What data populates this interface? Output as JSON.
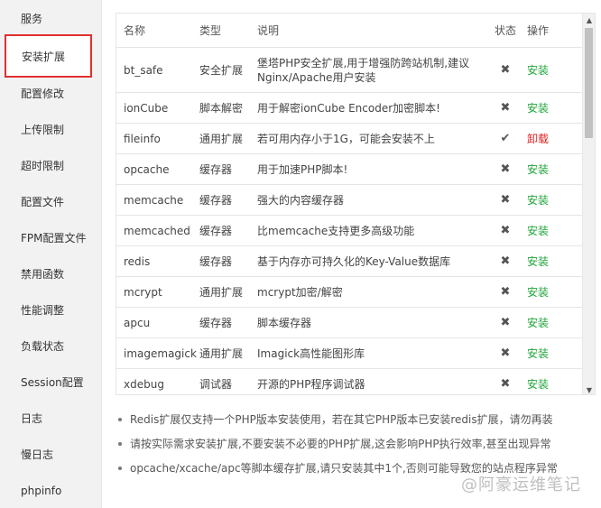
{
  "sidebar": {
    "items": [
      {
        "label": "服务"
      },
      {
        "label": "安装扩展"
      },
      {
        "label": "配置修改"
      },
      {
        "label": "上传限制"
      },
      {
        "label": "超时限制"
      },
      {
        "label": "配置文件"
      },
      {
        "label": "FPM配置文件"
      },
      {
        "label": "禁用函数"
      },
      {
        "label": "性能调整"
      },
      {
        "label": "负载状态"
      },
      {
        "label": "Session配置"
      },
      {
        "label": "日志"
      },
      {
        "label": "慢日志"
      },
      {
        "label": "phpinfo"
      }
    ],
    "active": "安装扩展"
  },
  "table": {
    "headers": {
      "name": "名称",
      "type": "类型",
      "desc": "说明",
      "status": "状态",
      "op": "操作"
    },
    "rows": [
      {
        "name": "bt_safe",
        "type": "安全扩展",
        "desc": "堡塔PHP安全扩展,用于增强防跨站机制,建议Nginx/Apache用户安装",
        "status": "✖",
        "op": "安装"
      },
      {
        "name": "ionCube",
        "type": "脚本解密",
        "desc": "用于解密ionCube Encoder加密脚本!",
        "status": "✖",
        "op": "安装"
      },
      {
        "name": "fileinfo",
        "type": "通用扩展",
        "desc": "若可用内存小于1G，可能会安装不上",
        "status": "✔",
        "op": "卸载"
      },
      {
        "name": "opcache",
        "type": "缓存器",
        "desc": "用于加速PHP脚本!",
        "status": "✖",
        "op": "安装"
      },
      {
        "name": "memcache",
        "type": "缓存器",
        "desc": "强大的内容缓存器",
        "status": "✖",
        "op": "安装"
      },
      {
        "name": "memcached",
        "type": "缓存器",
        "desc": "比memcache支持更多高级功能",
        "status": "✖",
        "op": "安装"
      },
      {
        "name": "redis",
        "type": "缓存器",
        "desc": "基于内存亦可持久化的Key-Value数据库",
        "status": "✖",
        "op": "安装"
      },
      {
        "name": "mcrypt",
        "type": "通用扩展",
        "desc": "mcrypt加密/解密",
        "status": "✖",
        "op": "安装"
      },
      {
        "name": "apcu",
        "type": "缓存器",
        "desc": "脚本缓存器",
        "status": "✖",
        "op": "安装"
      },
      {
        "name": "imagemagick",
        "type": "通用扩展",
        "desc": "Imagick高性能图形库",
        "status": "✖",
        "op": "安装"
      },
      {
        "name": "xdebug",
        "type": "调试器",
        "desc": "开源的PHP程序调试器",
        "status": "✖",
        "op": "安装"
      }
    ]
  },
  "notes": [
    "Redis扩展仅支持一个PHP版本安装使用，若在其它PHP版本已安装redis扩展，请勿再装",
    "请按实际需求安装扩展,不要安装不必要的PHP扩展,这会影响PHP执行效率,甚至出现异常",
    "opcache/xcache/apc等脚本缓存扩展,请只安装其中1个,否则可能导致您的站点程序异常"
  ],
  "watermark": "@阿豪运维笔记",
  "colors": {
    "install": "#20a53a",
    "uninstall": "#e02020",
    "highlight": "#e03030"
  }
}
